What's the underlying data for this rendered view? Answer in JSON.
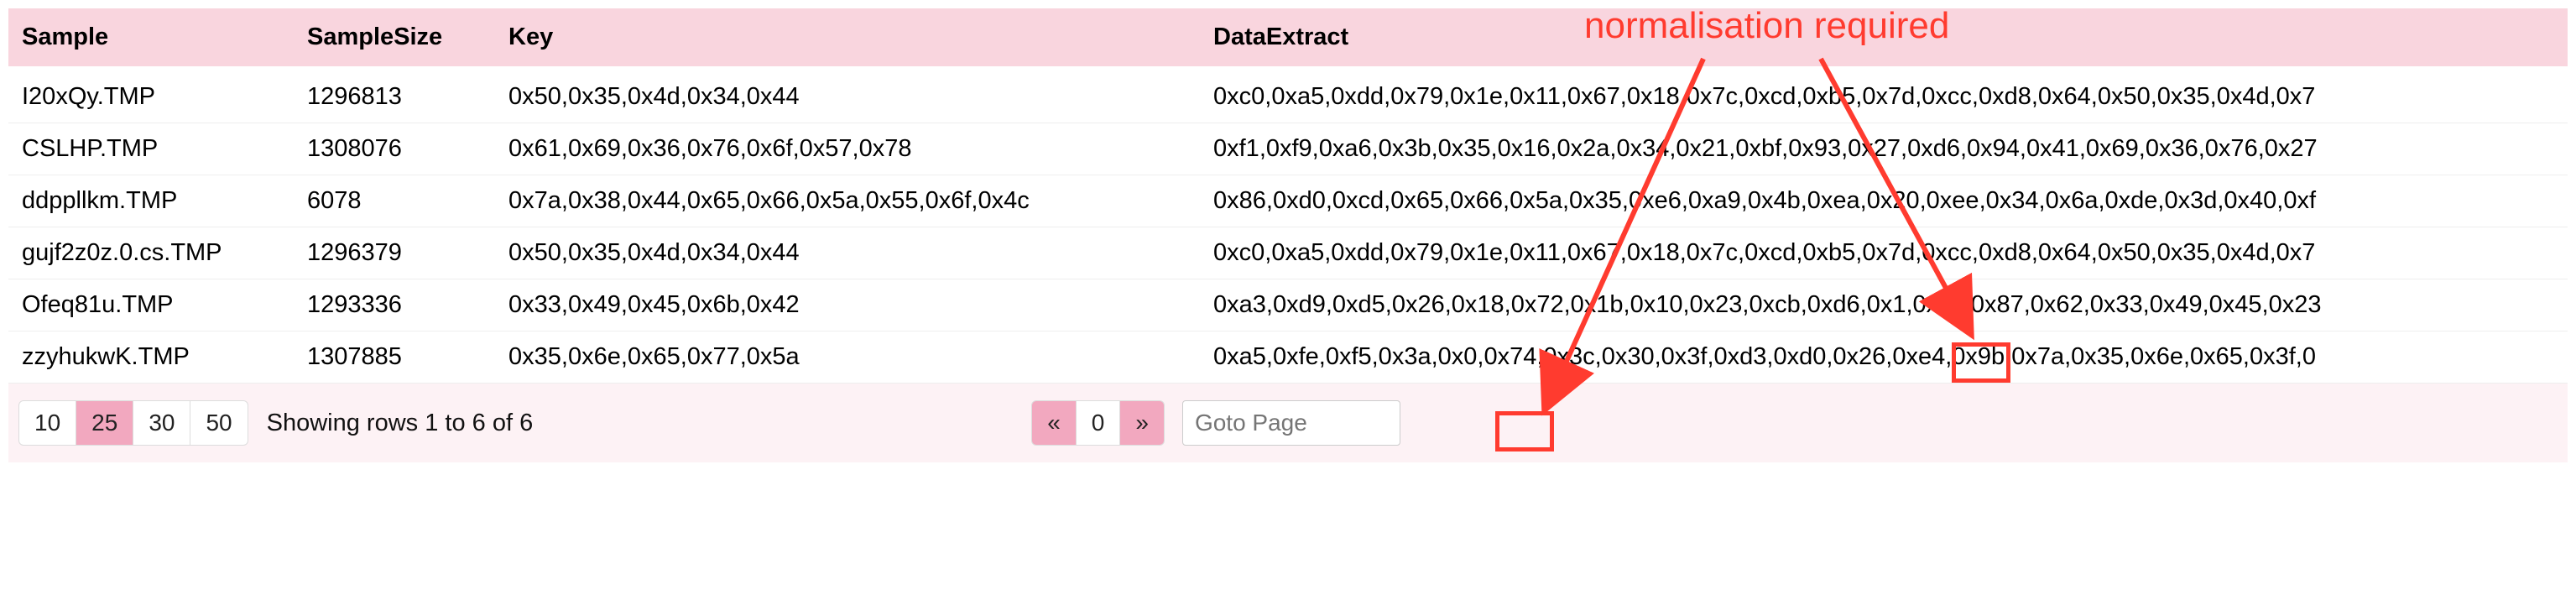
{
  "columns": {
    "sample": "Sample",
    "size": "SampleSize",
    "key": "Key",
    "extract": "DataExtract"
  },
  "rows": [
    {
      "sample": "I20xQy.TMP",
      "size": "1296813",
      "key": "0x50,0x35,0x4d,0x34,0x44",
      "extract": "0xc0,0xa5,0xdd,0x79,0x1e,0x11,0x67,0x18,0x7c,0xcd,0xb5,0x7d,0xcc,0xd8,0x64,0x50,0x35,0x4d,0x7"
    },
    {
      "sample": "CSLHP.TMP",
      "size": "1308076",
      "key": "0x61,0x69,0x36,0x76,0x6f,0x57,0x78",
      "extract": "0xf1,0xf9,0xa6,0x3b,0x35,0x16,0x2a,0x34,0x21,0xbf,0x93,0x27,0xd6,0x94,0x41,0x69,0x36,0x76,0x27"
    },
    {
      "sample": "ddppllkm.TMP",
      "size": "6078",
      "key": "0x7a,0x38,0x44,0x65,0x66,0x5a,0x55,0x6f,0x4c",
      "extract": "0x86,0xd0,0xcd,0x65,0x66,0x5a,0x35,0xe6,0xa9,0x4b,0xea,0x20,0xee,0x34,0x6a,0xde,0x3d,0x40,0xf"
    },
    {
      "sample": "gujf2z0z.0.cs.TMP",
      "size": "1296379",
      "key": "0x50,0x35,0x4d,0x34,0x44",
      "extract": "0xc0,0xa5,0xdd,0x79,0x1e,0x11,0x67,0x18,0x7c,0xcd,0xb5,0x7d,0xcc,0xd8,0x64,0x50,0x35,0x4d,0x7"
    },
    {
      "sample": "Ofeq81u.TMP",
      "size": "1293336",
      "key": "0x33,0x49,0x45,0x6b,0x42",
      "extract": "0xa3,0xd9,0xd5,0x26,0x18,0x72,0x1b,0x10,0x23,0xcb,0xd6,0x1,0xc4,0x87,0x62,0x33,0x49,0x45,0x23"
    },
    {
      "sample": "zzyhukwK.TMP",
      "size": "1307885",
      "key": "0x35,0x6e,0x65,0x77,0x5a",
      "extract": "0xa5,0xfe,0xf5,0x3a,0x0,0x74,0x3c,0x30,0x3f,0xd3,0xd0,0x26,0xe4,0x9b,0x7a,0x35,0x6e,0x65,0x3f,0"
    }
  ],
  "pager": {
    "sizes": [
      "10",
      "25",
      "30",
      "50"
    ],
    "active_size_index": 1,
    "status": "Showing rows 1 to 6 of 6",
    "prev": "«",
    "page": "0",
    "next": "»",
    "goto_placeholder": "Goto Page"
  },
  "annotation": {
    "label": "normalisation required",
    "box1_target": "0x0",
    "box2_target": "0x1"
  }
}
